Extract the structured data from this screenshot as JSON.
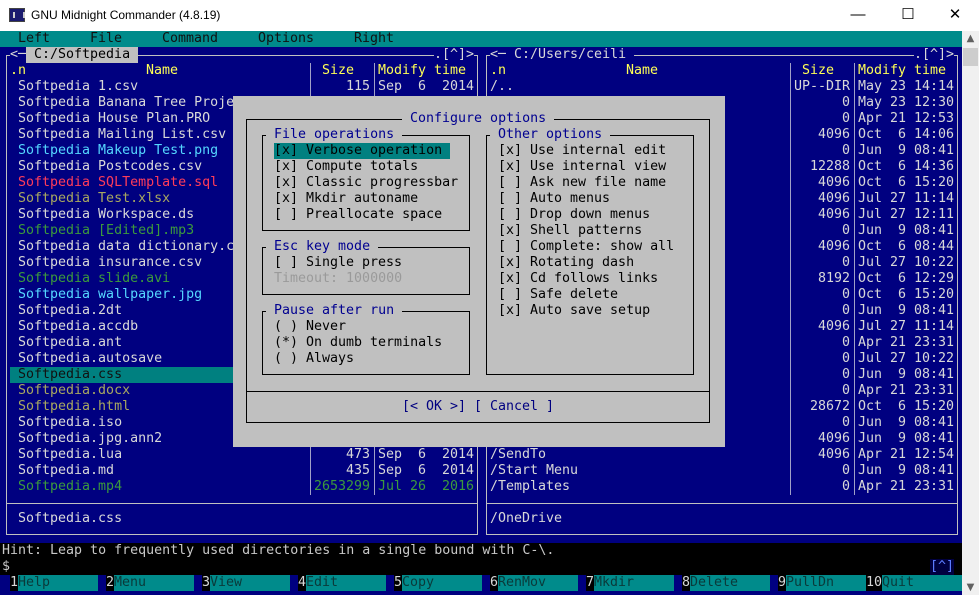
{
  "window": {
    "title": "GNU Midnight Commander (4.8.19)",
    "minimize": "—",
    "maximize": "☐",
    "close": "✕"
  },
  "menu": [
    "Left",
    "File",
    "Command",
    "Options",
    "Right"
  ],
  "colors": {
    "background": "#000080",
    "accent": "#008b8b",
    "header": "#ffff55",
    "dialog": "#c0c0c0"
  },
  "left_panel": {
    "path": " C:/Softpedia ",
    "left_marker": "<─",
    "right_marker": ".[^]>",
    "headers": {
      "n": ".n",
      "name": "Name",
      "size": "Size",
      "time": "Modify time"
    },
    "files": [
      {
        "name": "Softpedia 1.csv",
        "size": "115",
        "time": "Sep  6  2014",
        "color": ""
      },
      {
        "name": "Softpedia Banana Tree Proje",
        "size": "",
        "time": "",
        "color": ""
      },
      {
        "name": "Softpedia House Plan.PRO",
        "size": "",
        "time": "",
        "color": ""
      },
      {
        "name": "Softpedia Mailing List.csv",
        "size": "",
        "time": "",
        "color": ""
      },
      {
        "name": "Softpedia Makeup Test.png",
        "size": "",
        "time": "",
        "color": "cyan"
      },
      {
        "name": "Softpedia Postcodes.csv",
        "size": "",
        "time": "",
        "color": ""
      },
      {
        "name": "Softpedia SQLTemplate.sql",
        "size": "",
        "time": "",
        "color": "red"
      },
      {
        "name": "Softpedia Test.xlsx",
        "size": "",
        "time": "",
        "color": "olive"
      },
      {
        "name": "Softpedia Workspace.ds",
        "size": "",
        "time": "",
        "color": ""
      },
      {
        "name": "Softpedia [Edited].mp3",
        "size": "",
        "time": "",
        "color": "green"
      },
      {
        "name": "Softpedia data dictionary.c",
        "size": "",
        "time": "",
        "color": ""
      },
      {
        "name": "Softpedia insurance.csv",
        "size": "",
        "time": "",
        "color": ""
      },
      {
        "name": "Softpedia slide.avi",
        "size": "",
        "time": "",
        "color": "green"
      },
      {
        "name": "Softpedia wallpaper.jpg",
        "size": "",
        "time": "",
        "color": "cyan"
      },
      {
        "name": "Softpedia.2dt",
        "size": "",
        "time": "",
        "color": ""
      },
      {
        "name": "Softpedia.accdb",
        "size": "",
        "time": "",
        "color": ""
      },
      {
        "name": "Softpedia.ant",
        "size": "",
        "time": "",
        "color": ""
      },
      {
        "name": "Softpedia.autosave",
        "size": "",
        "time": "",
        "color": ""
      },
      {
        "name": "Softpedia.css",
        "size": "",
        "time": "",
        "color": "",
        "selected": true
      },
      {
        "name": "Softpedia.docx",
        "size": "",
        "time": "",
        "color": "olive"
      },
      {
        "name": "Softpedia.html",
        "size": "",
        "time": "",
        "color": "olive"
      },
      {
        "name": "Softpedia.iso",
        "size": "",
        "time": "",
        "color": ""
      },
      {
        "name": "Softpedia.jpg.ann2",
        "size": "",
        "time": "",
        "color": ""
      },
      {
        "name": "Softpedia.lua",
        "size": "473",
        "time": "Sep  6  2014",
        "color": ""
      },
      {
        "name": "Softpedia.md",
        "size": "435",
        "time": "Sep  6  2014",
        "color": ""
      },
      {
        "name": "Softpedia.mp4",
        "size": "2653299",
        "time": "Jul 26  2016",
        "color": "green"
      }
    ],
    "status": "Softpedia.css"
  },
  "right_panel": {
    "path": " C:/Users/ceili ",
    "left_marker": "<─",
    "right_marker": ".[^]>",
    "headers": {
      "n": ".n",
      "name": "Name",
      "size": "Size",
      "time": "Modify time"
    },
    "files": [
      {
        "name": "/..",
        "size": "UP--DIR",
        "time": "May 23 14:14"
      },
      {
        "name": "",
        "size": "0",
        "time": "May 23 12:30"
      },
      {
        "name": "",
        "size": "0",
        "time": "Apr 21 12:53"
      },
      {
        "name": "",
        "size": "4096",
        "time": "Oct  6 14:06"
      },
      {
        "name": "",
        "size": "0",
        "time": "Jun  9 08:41"
      },
      {
        "name": "",
        "size": "12288",
        "time": "Oct  6 14:36"
      },
      {
        "name": "",
        "size": "4096",
        "time": "Oct  6 15:20"
      },
      {
        "name": "",
        "size": "4096",
        "time": "Jul 27 11:14"
      },
      {
        "name": "",
        "size": "4096",
        "time": "Jul 27 12:11"
      },
      {
        "name": "",
        "size": "0",
        "time": "Jun  9 08:41"
      },
      {
        "name": "",
        "size": "4096",
        "time": "Oct  6 08:44"
      },
      {
        "name": "",
        "size": "0",
        "time": "Jul 27 10:22"
      },
      {
        "name": "",
        "size": "8192",
        "time": "Oct  6 12:29"
      },
      {
        "name": "",
        "size": "0",
        "time": "Oct  6 15:20"
      },
      {
        "name": "",
        "size": "0",
        "time": "Jun  9 08:41"
      },
      {
        "name": "",
        "size": "4096",
        "time": "Jul 27 11:14"
      },
      {
        "name": "",
        "size": "0",
        "time": "Apr 21 23:31"
      },
      {
        "name": "",
        "size": "0",
        "time": "Jul 27 10:22"
      },
      {
        "name": "",
        "size": "0",
        "time": "Jun  9 08:41"
      },
      {
        "name": "",
        "size": "0",
        "time": "Apr 21 23:31"
      },
      {
        "name": "",
        "size": "28672",
        "time": "Oct  6 15:20"
      },
      {
        "name": "",
        "size": "0",
        "time": "Jun  9 08:41"
      },
      {
        "name": "",
        "size": "4096",
        "time": "Jun  9 08:41"
      },
      {
        "name": "/SendTo",
        "size": "4096",
        "time": "Apr 21 12:54"
      },
      {
        "name": "/Start Menu",
        "size": "0",
        "time": "Jun  9 08:41"
      },
      {
        "name": "/Templates",
        "size": "0",
        "time": "Apr 21 23:31"
      }
    ],
    "status": "/OneDrive"
  },
  "dialog": {
    "title": " Configure options ",
    "file_operations": {
      "title": " File operations ",
      "items": [
        {
          "mark": "[x]",
          "label": "Verbose operation",
          "focused": true
        },
        {
          "mark": "[x]",
          "label": "Compute totals"
        },
        {
          "mark": "[x]",
          "label": "Classic progressbar"
        },
        {
          "mark": "[x]",
          "label": "Mkdir autoname"
        },
        {
          "mark": "[ ]",
          "label": "Preallocate space"
        }
      ]
    },
    "esc_key_mode": {
      "title": " Esc key mode ",
      "items": [
        {
          "mark": "[ ]",
          "label": "Single press"
        }
      ],
      "timeout": "Timeout: 1000000"
    },
    "pause_after_run": {
      "title": " Pause after run ",
      "items": [
        {
          "mark": "( )",
          "label": "Never"
        },
        {
          "mark": "(*)",
          "label": "On dumb terminals"
        },
        {
          "mark": "( )",
          "label": "Always"
        }
      ]
    },
    "other_options": {
      "title": " Other options ",
      "items": [
        {
          "mark": "[x]",
          "label": "Use internal edit"
        },
        {
          "mark": "[x]",
          "label": "Use internal view"
        },
        {
          "mark": "[ ]",
          "label": "Ask new file name"
        },
        {
          "mark": "[ ]",
          "label": "Auto menus"
        },
        {
          "mark": "[ ]",
          "label": "Drop down menus"
        },
        {
          "mark": "[x]",
          "label": "Shell patterns"
        },
        {
          "mark": "[ ]",
          "label": "Complete: show all"
        },
        {
          "mark": "[x]",
          "label": "Rotating dash"
        },
        {
          "mark": "[x]",
          "label": "Cd follows links"
        },
        {
          "mark": "[ ]",
          "label": "Safe delete"
        },
        {
          "mark": "[x]",
          "label": "Auto save setup"
        }
      ]
    },
    "ok": "[< OK >]",
    "cancel": "[ Cancel ]"
  },
  "hint": "Hint: Leap to frequently used directories in a single bound with C-\\.",
  "prompt": "$",
  "history_button": "[^]",
  "fkeys": [
    {
      "n": "1",
      "label": "Help"
    },
    {
      "n": "2",
      "label": "Menu"
    },
    {
      "n": "3",
      "label": "View"
    },
    {
      "n": "4",
      "label": "Edit"
    },
    {
      "n": "5",
      "label": "Copy"
    },
    {
      "n": "6",
      "label": "RenMov"
    },
    {
      "n": "7",
      "label": "Mkdir"
    },
    {
      "n": "8",
      "label": "Delete"
    },
    {
      "n": "9",
      "label": "PullDn"
    },
    {
      "n": "10",
      "label": "Quit"
    }
  ]
}
